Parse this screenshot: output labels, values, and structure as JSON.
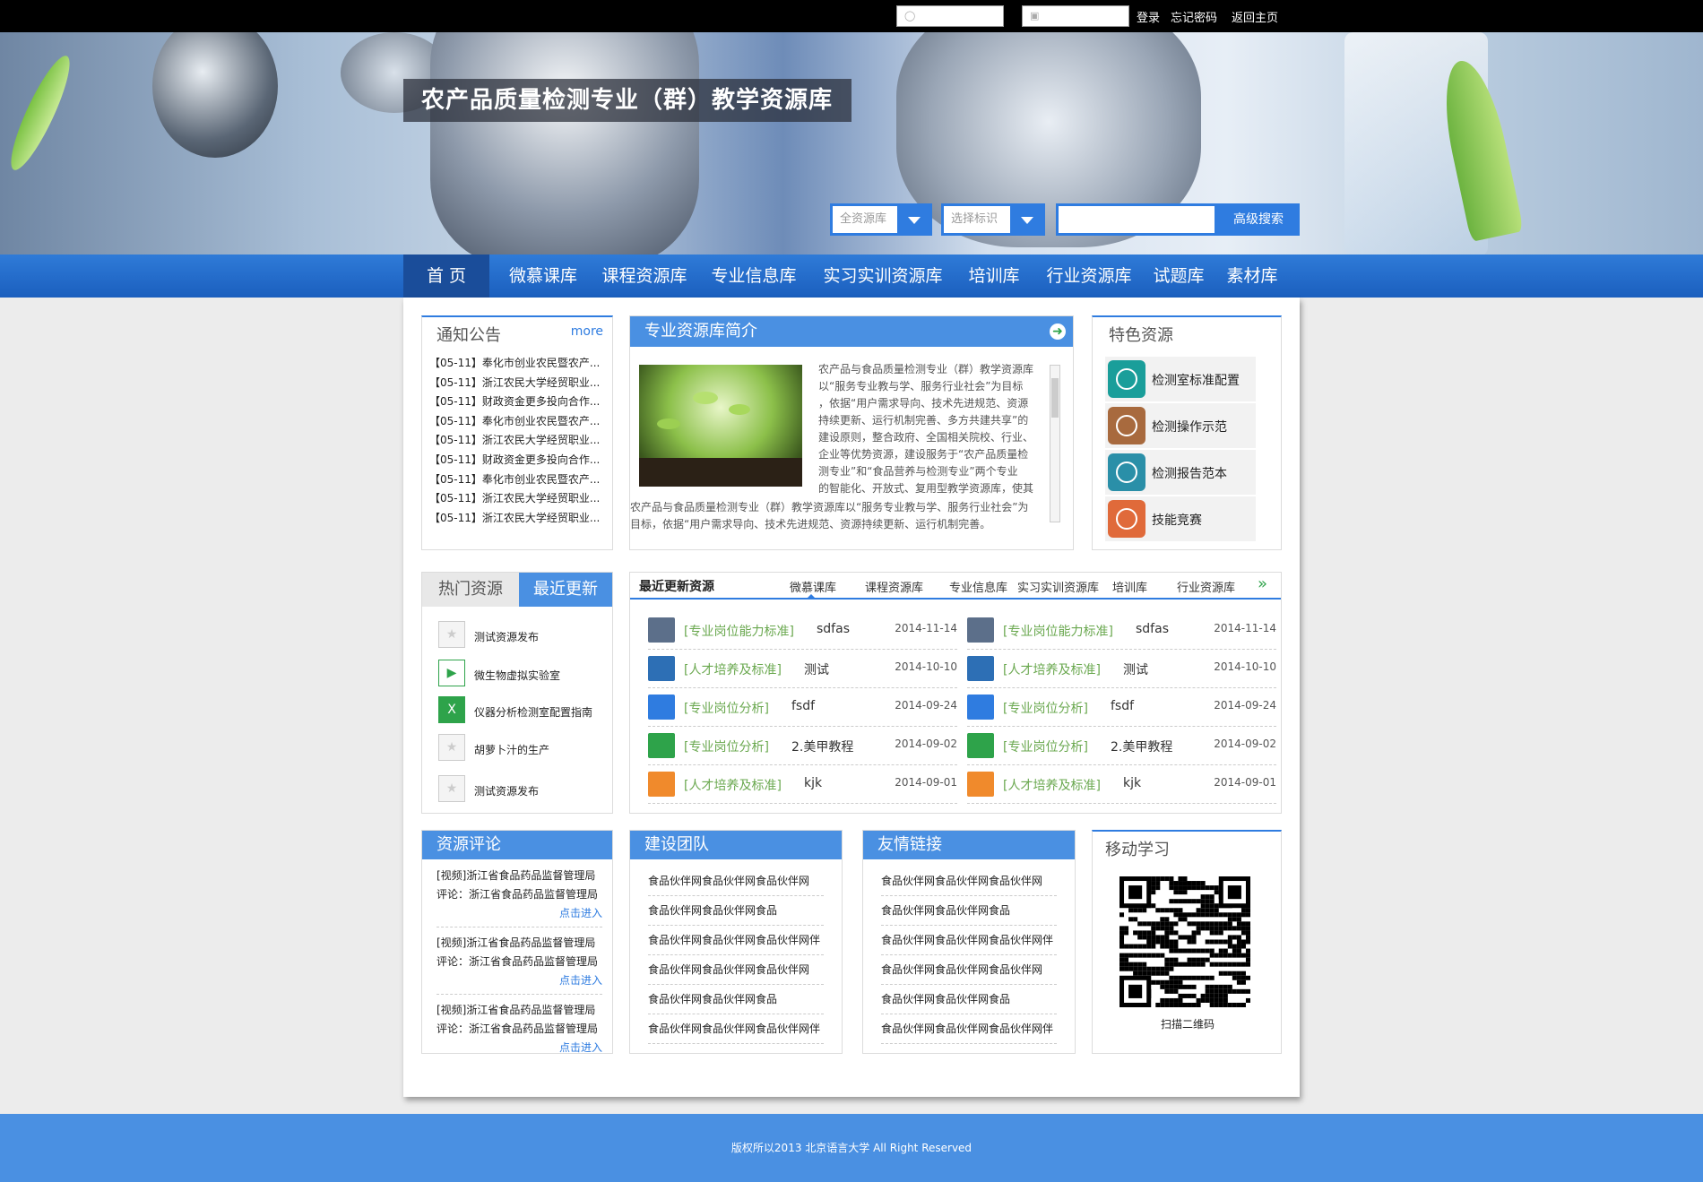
{
  "topbar": {
    "login_label": "登录",
    "forgot_label": "忘记密码",
    "home_label": "返回主页"
  },
  "banner": {
    "title": "农产品质量检测专业（群）教学资源库",
    "select1": "全资源库",
    "select2": "选择标识",
    "search_button": "高级搜索"
  },
  "nav": [
    "首 页",
    "微慕课库",
    "课程资源库",
    "专业信息库",
    "实习实训资源库",
    "培训库",
    "行业资源库",
    "试题库",
    "素材库"
  ],
  "notice": {
    "title": "通知公告",
    "more": "more",
    "items": [
      {
        "date": "【05-11】",
        "text": "奉化市创业农民暨农产..."
      },
      {
        "date": "【05-11】",
        "text": "浙江农民大学经贸职业..."
      },
      {
        "date": "【05-11】",
        "text": "财政资金更多投向合作..."
      },
      {
        "date": "【05-11】",
        "text": "奉化市创业农民暨农产..."
      },
      {
        "date": "【05-11】",
        "text": "浙江农民大学经贸职业..."
      },
      {
        "date": "【05-11】",
        "text": "财政资金更多投向合作..."
      },
      {
        "date": "【05-11】",
        "text": "奉化市创业农民暨农产..."
      },
      {
        "date": "【05-11】",
        "text": "浙江农民大学经贸职业..."
      },
      {
        "date": "【05-11】",
        "text": "浙江农民大学经贸职业..."
      }
    ]
  },
  "intro": {
    "title": "专业资源库简介",
    "lines": [
      "农产品与食品质量检测专业（群）教学资源库",
      "以“服务专业教与学、服务行业社会”为目标",
      "，依据“用户需求导向、技术先进规范、资源",
      "持续更新、运行机制完善、多方共建共享”的",
      "建设原则，整合政府、全国相关院校、行业、",
      "企业等优势资源，建设服务于“农产品质量检",
      "测专业”和“食品营养与检测专业”两个专业",
      "的智能化、开放式、复用型教学资源库，使其"
    ],
    "bottom_lines": [
      "农产品与食品质量检测专业（群）教学资源库以“服务专业教与学、服务行业社会”为",
      "目标，依据“用户需求导向、技术先进规范、资源持续更新、运行机制完善。"
    ]
  },
  "featured": {
    "title": "特色资源",
    "items": [
      {
        "label": "检测室标准配置",
        "color": "#1a9e9a",
        "icon": "target-icon"
      },
      {
        "label": "检测操作示范",
        "color": "#a86a3e",
        "icon": "screen-icon"
      },
      {
        "label": "检测报告范本",
        "color": "#2a8fa8",
        "icon": "card-icon"
      },
      {
        "label": "技能竞赛",
        "color": "#e06a3a",
        "icon": "flag-icon"
      }
    ]
  },
  "hot": {
    "tab_hot": "热门资源",
    "tab_new": "最近更新",
    "items": [
      {
        "label": "测试资源发布",
        "icon": "star-icon"
      },
      {
        "label": "微生物虚拟实验室",
        "icon": "video-icon"
      },
      {
        "label": "仪器分析检测室配置指南",
        "icon": "excel-icon"
      },
      {
        "label": "胡萝卜汁的生产",
        "icon": "star-icon"
      },
      {
        "label": "测试资源发布",
        "icon": "star-icon"
      }
    ]
  },
  "updates": {
    "title": "最近更新资源",
    "tabs": [
      "微慕课库",
      "课程资源库",
      "专业信息库",
      "实习实训资源库",
      "培训库",
      "行业资源库"
    ],
    "more_symbol": "»",
    "items": [
      {
        "cat": "[专业岗位能力标准]",
        "name": "sdfas",
        "date": "2014-11-14",
        "icon": "txt-icon",
        "color": "#5c6f8a"
      },
      {
        "cat": "[人才培养及标准]",
        "name": "测试",
        "date": "2014-10-10",
        "icon": "pic-icon",
        "color": "#2d6fb5"
      },
      {
        "cat": "[专业岗位分析]",
        "name": "fsdf",
        "date": "2014-09-24",
        "icon": "word-icon",
        "color": "#2f7ce0"
      },
      {
        "cat": "[专业岗位分析]",
        "name": "2.美甲教程",
        "date": "2014-09-02",
        "icon": "video-icon",
        "color": "#2ea34a"
      },
      {
        "cat": "[人才培养及标准]",
        "name": "kjk",
        "date": "2014-09-01",
        "icon": "music-icon",
        "color": "#f08a2c"
      }
    ]
  },
  "comments": {
    "title": "资源评论",
    "items": [
      {
        "line1": "[视频]浙江省食品药品监督管理局",
        "line2": "评论：浙江省食品药品监督管理局",
        "go": "点击进入"
      },
      {
        "line1": "[视频]浙江省食品药品监督管理局",
        "line2": "评论：浙江省食品药品监督管理局",
        "go": "点击进入"
      },
      {
        "line1": "[视频]浙江省食品药品监督管理局",
        "line2": "评论：浙江省食品药品监督管理局",
        "go": "点击进入"
      }
    ]
  },
  "team": {
    "title": "建设团队",
    "items": [
      "食品伙伴网食品伙伴网食品伙伴网",
      "食品伙伴网食品伙伴网食品",
      "食品伙伴网食品伙伴网食品伙伴网伴",
      "食品伙伴网食品伙伴网食品伙伴网",
      "食品伙伴网食品伙伴网食品",
      "食品伙伴网食品伙伴网食品伙伴网伴"
    ]
  },
  "links": {
    "title": "友情链接",
    "items": [
      "食品伙伴网食品伙伴网食品伙伴网",
      "食品伙伴网食品伙伴网食品",
      "食品伙伴网食品伙伴网食品伙伴网伴",
      "食品伙伴网食品伙伴网食品伙伴网",
      "食品伙伴网食品伙伴网食品",
      "食品伙伴网食品伙伴网食品伙伴网伴"
    ]
  },
  "mobile": {
    "title": "移动学习",
    "caption": "扫描二维码"
  },
  "footer": {
    "text": "版权所以2013  北京语言大学  All Right Reserved"
  }
}
